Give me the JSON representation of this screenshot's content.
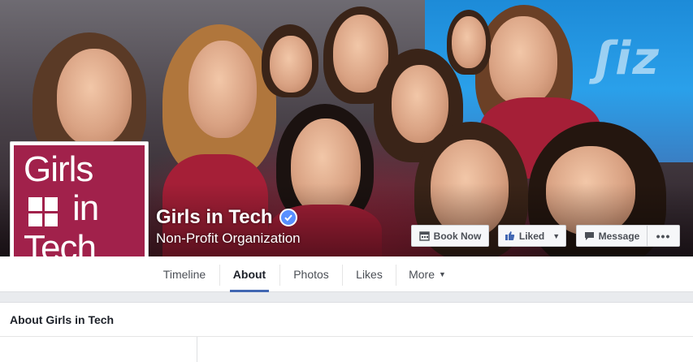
{
  "page": {
    "name": "Girls in Tech",
    "category": "Non-Profit Organization",
    "verified": true
  },
  "logo": {
    "line1": "Girls",
    "line2": "in",
    "line3": "Tech",
    "color": "#a1214b"
  },
  "cover_buttons": {
    "book_now": "Book Now",
    "liked": "Liked",
    "message": "Message",
    "more": "•••"
  },
  "nav": {
    "tabs": [
      {
        "label": "Timeline"
      },
      {
        "label": "About"
      },
      {
        "label": "Photos"
      },
      {
        "label": "Likes"
      },
      {
        "label": "More"
      }
    ],
    "active": "About"
  },
  "about": {
    "header": "About Girls in Tech"
  },
  "colors": {
    "accent": "#4267b2",
    "verified": "#5890ff",
    "brand": "#a1214b"
  }
}
